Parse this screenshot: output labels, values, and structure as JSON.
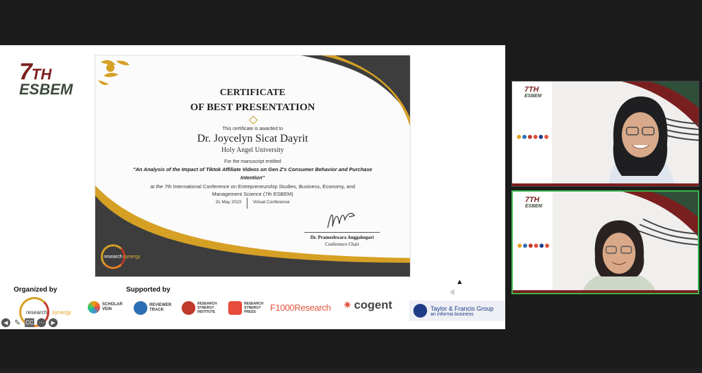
{
  "slide": {
    "conf_logo": {
      "number": "7",
      "suffix": "TH",
      "name": "ESBEM"
    },
    "certificate": {
      "title_line1": "CERTIFICATE",
      "title_line2": "OF BEST PRESENTATION",
      "awarded_text": "This certificate is awarded to",
      "recipient": "Dr. Joycelyn Sicat Dayrit",
      "university": "Holy Angel University",
      "for_text": "For the manuscript entitled",
      "paper_title": "\"An Analysis of the Impact of Tiktok Affiliate Videos on Gen Z's Consumer Behavior and Purchase Intention\"",
      "conference_text": "at the 7th International Conference on Entrepreneurship Studies, Business, Economy, and Management Science (7th ESBEM)",
      "date": "31 May 2023",
      "mode": "Virtual Conference",
      "signer_name": "Dr. Prameshwara Anggahegari",
      "signer_role": "Conference Chair",
      "org_logo_text": "research",
      "org_logo_text2": "synergy"
    },
    "organized_label": "Organized by",
    "supported_label": "Supported by",
    "organizer": {
      "text1": "research",
      "text2": "synergy"
    },
    "sponsors": {
      "scholar_vein": [
        "SCHOLAR",
        "VEIN"
      ],
      "reviewer_track": [
        "REVIEWER",
        "TRACK"
      ],
      "rs_institute": [
        "RESEARCH",
        "SYNERGY",
        "INSTITUTE"
      ],
      "rs_press": [
        "RESEARCH",
        "SYNERGY",
        "PRESS"
      ],
      "f1000": "F1000Research",
      "cogent": "cogent",
      "tf_line1": "Taylor & Francis Group",
      "tf_line2": "an informa business"
    },
    "controls": {
      "cc": "CC"
    }
  },
  "videos": {
    "v1": {
      "conf_num": "7TH",
      "conf_name": "ESBEM"
    },
    "v2": {
      "conf_num": "7TH",
      "conf_name": "ESBEM"
    }
  },
  "colors": {
    "gold": "#d6a025",
    "dark": "#3d3d3d",
    "maroon": "#7a1f1f",
    "active_speaker": "#3ab54a"
  }
}
